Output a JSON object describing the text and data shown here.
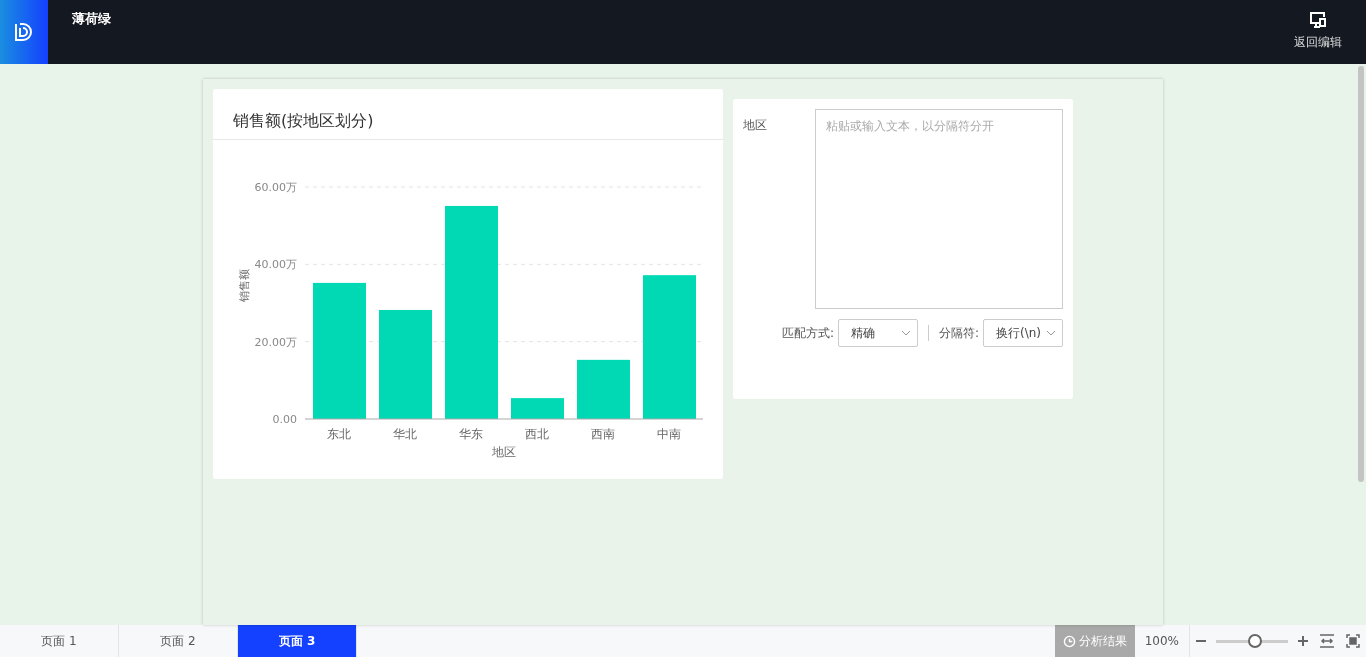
{
  "header": {
    "title": "薄荷绿",
    "action": "返回编辑"
  },
  "chart_card": {
    "title": "销售额(按地区划分)",
    "chart_data": {
      "type": "bar",
      "xlabel": "地区",
      "ylabel": "销售额",
      "categories": [
        "东北",
        "华北",
        "华东",
        "西北",
        "西南",
        "中南"
      ],
      "series": [
        {
          "color": "#00d9b4",
          "values": [
            35.2,
            28.2,
            55.1,
            5.4,
            15.3,
            37.2
          ]
        }
      ],
      "ylim": [
        0,
        60
      ],
      "yticks": [
        {
          "value": 0,
          "label": "0.00"
        },
        {
          "value": 20,
          "label": "20.00万"
        },
        {
          "value": 40,
          "label": "40.00万"
        },
        {
          "value": 60,
          "label": "60.00万"
        }
      ]
    }
  },
  "filter": {
    "label": "地区",
    "placeholder": "粘贴或输入文本，以分隔符分开",
    "match_label": "匹配方式:",
    "match_value": "精确",
    "separator_label": "分隔符:",
    "separator_value": "换行(\\n)"
  },
  "page_tabs": [
    {
      "label": "页面 1",
      "selected": false
    },
    {
      "label": "页面 2",
      "selected": false
    },
    {
      "label": "页面 3",
      "selected": true
    }
  ],
  "status": {
    "analysis": "分析结果",
    "zoom": "100%",
    "zoom_slider": {
      "level": 0.54
    }
  }
}
